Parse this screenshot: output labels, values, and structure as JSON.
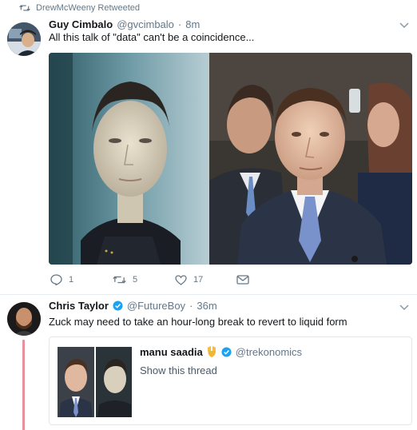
{
  "retweet_label": "DrewMcWeeny Retweeted",
  "tweets": [
    {
      "name": "Guy Cimbalo",
      "handle": "@gvcimbalo",
      "separator": "·",
      "time": "8m",
      "text": "All this talk of \"data\" can't be a coincidence...",
      "stats": {
        "replies": "1",
        "retweets": "5",
        "likes": "17"
      }
    },
    {
      "name": "Chris Taylor",
      "handle": "@FutureBoy",
      "separator": "·",
      "time": "36m",
      "text": "Zuck may need to take an hour-long break to revert to liquid form",
      "quote": {
        "name": "manu saadia",
        "emoji_icon": "vulcan-salute-icon",
        "handle": "@trekonomics",
        "link_text": "Show this thread"
      }
    }
  ],
  "colors": {
    "text_primary": "#14171a",
    "text_secondary": "#657786",
    "verified_blue": "#1da1f2",
    "thread_line": "#e8909c",
    "border": "#e1e8ed"
  }
}
